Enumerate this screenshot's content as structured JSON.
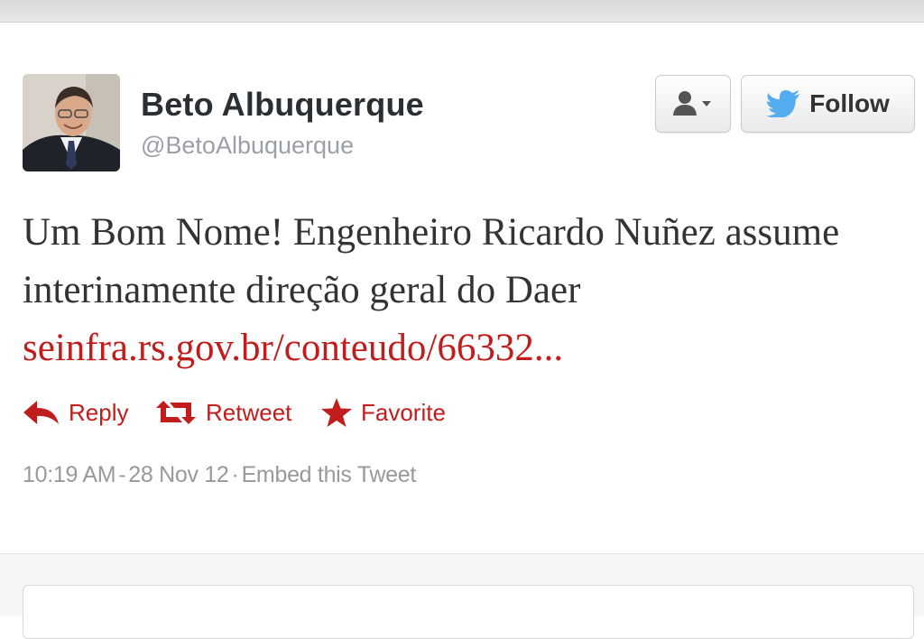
{
  "profile": {
    "name": "Beto Albuquerque",
    "handle": "@BetoAlbuquerque"
  },
  "buttons": {
    "follow_label": "Follow"
  },
  "tweet": {
    "text": "Um Bom Nome! Engenheiro Ricardo Nuñez assume interinamente direção geral do Daer",
    "link": "seinfra.rs.gov.br/conteudo/66332..."
  },
  "actions": {
    "reply": "Reply",
    "retweet": "Retweet",
    "favorite": "Favorite"
  },
  "meta": {
    "time": "10:19 AM",
    "date": "28 Nov 12",
    "embed": "Embed this Tweet"
  },
  "icons": {
    "accent": "#c21d1d",
    "twitter_bird": "#55acee"
  }
}
